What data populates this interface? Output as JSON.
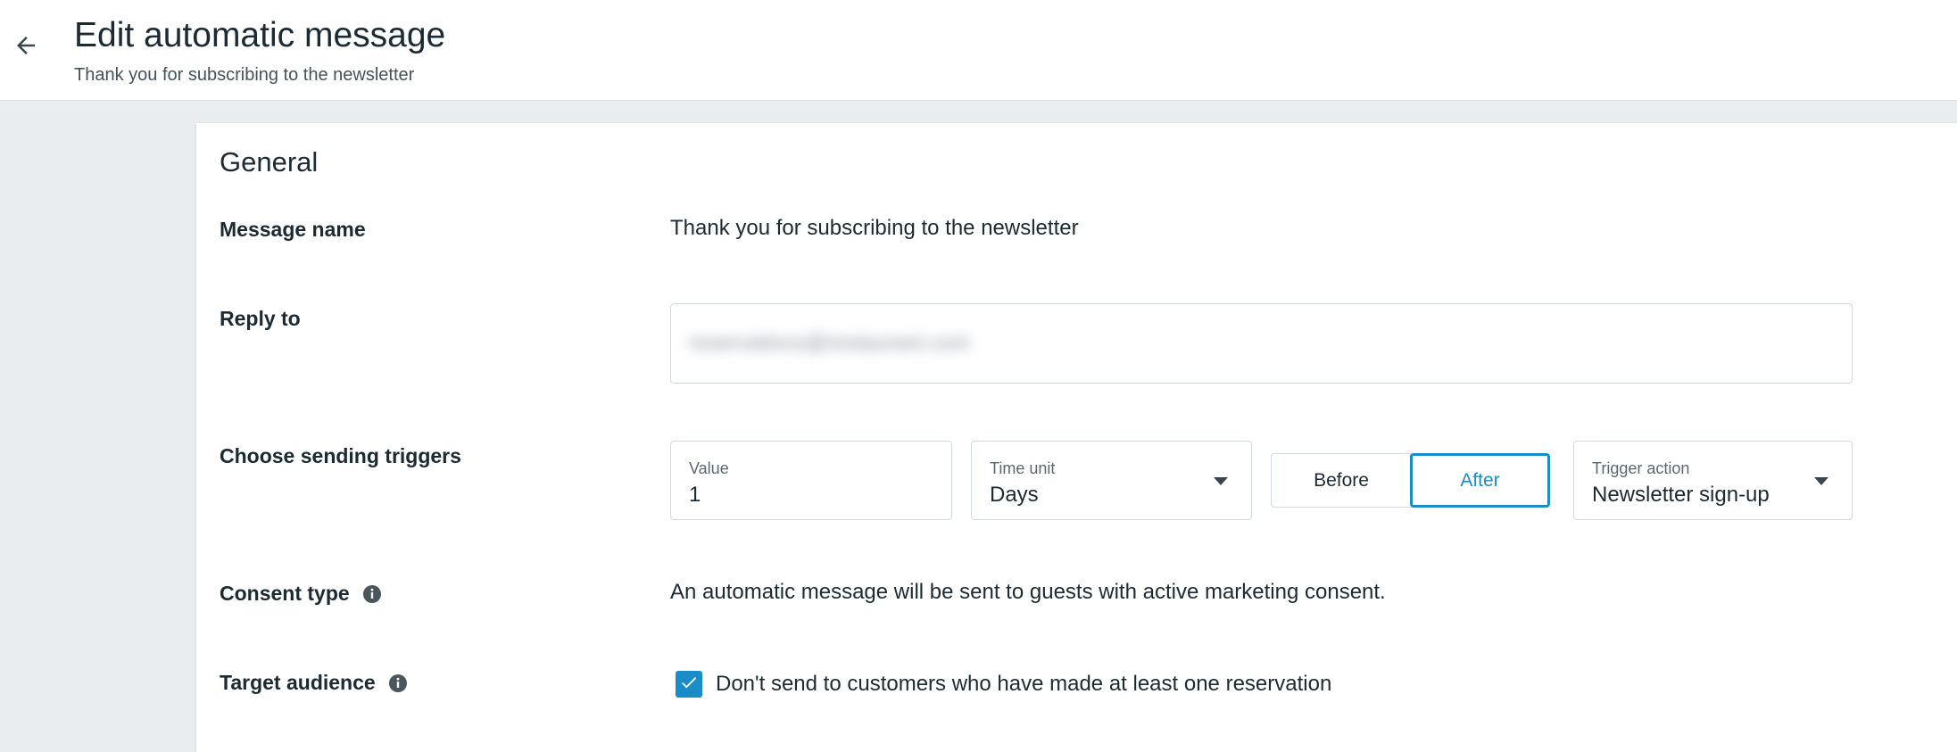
{
  "header": {
    "title": "Edit automatic message",
    "subtitle": "Thank you for subscribing to the newsletter",
    "back_icon": "arrow-left-icon"
  },
  "general": {
    "section_title": "General",
    "message_name": {
      "label": "Message name",
      "value": "Thank you for subscribing to the newsletter"
    },
    "reply_to": {
      "label": "Reply to",
      "value": "reservations@restaurant.com"
    },
    "triggers": {
      "label": "Choose sending triggers",
      "value_field": {
        "caption": "Value",
        "value": "1"
      },
      "time_unit": {
        "caption": "Time unit",
        "value": "Days"
      },
      "timing_options": [
        "Before",
        "After"
      ],
      "timing_selected": "After",
      "trigger_action": {
        "caption": "Trigger action",
        "value": "Newsletter sign-up"
      }
    },
    "consent_type": {
      "label": "Consent type",
      "text": "An automatic message will be sent to guests with active marketing consent."
    },
    "target_audience": {
      "label": "Target audience",
      "checkbox_label": "Don't send to customers who have made at least one reservation",
      "checked": true
    }
  },
  "colors": {
    "accent": "#1a8cc7",
    "page_background": "#e9edf0",
    "text": "#1c2a33"
  }
}
